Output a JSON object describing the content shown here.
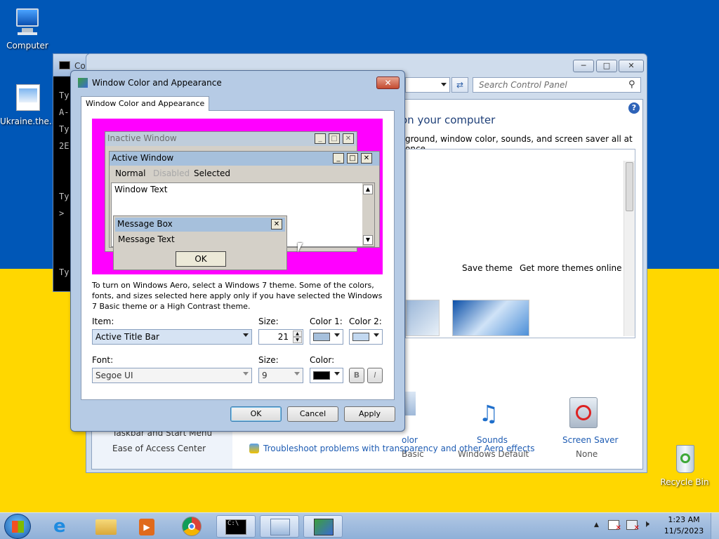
{
  "desktop": {
    "icons": [
      {
        "label": "Computer"
      },
      {
        "label": "Ukraine.the..."
      },
      {
        "label": "Recycle Bin"
      }
    ]
  },
  "cmd": {
    "title": "Co",
    "lines": [
      "Ty",
      "A-",
      "Ty",
      "2E",
      "Ty",
      ">",
      "Ty"
    ]
  },
  "control_panel": {
    "search_placeholder": "Search Control Panel",
    "heading": "on your computer",
    "subtext": "ground, window color, sounds, and screen saver all at once.",
    "save_theme": "Save theme",
    "get_more_themes": "Get more themes online",
    "left_links": [
      "Taskbar and Start Menu",
      "Ease of Access Center"
    ],
    "troubleshoot_link": "Troubleshoot problems with transparency and other Aero effects",
    "bottom_items": [
      {
        "label": "olor",
        "sub": "Basic"
      },
      {
        "label": "Sounds",
        "sub": "Windows Default"
      },
      {
        "label": "Screen Saver",
        "sub": "None"
      }
    ]
  },
  "dialog": {
    "title": "Window Color and Appearance",
    "tab": "Window Color and Appearance",
    "preview": {
      "inactive": "Inactive Window",
      "active": "Active Window",
      "menu_normal": "Normal",
      "menu_disabled": "Disabled",
      "menu_selected": "Selected",
      "window_text": "Window Text",
      "msgbox_title": "Message Box",
      "msgbox_text": "Message Text",
      "msgbox_ok": "OK"
    },
    "info": "To turn on Windows Aero, select a Windows 7 theme.  Some of the colors, fonts, and sizes selected here apply only if you have selected the Windows 7 Basic theme or a High Contrast theme.",
    "item_label": "Item:",
    "item_value": "Active Title Bar",
    "size_label": "Size:",
    "size_value": "21",
    "color1_label": "Color 1:",
    "color2_label": "Color 2:",
    "font_label": "Font:",
    "font_value": "Segoe UI",
    "font_size_label": "Size:",
    "font_size_value": "9",
    "font_color_label": "Color:",
    "bold": "B",
    "italic": "I",
    "ok": "OK",
    "cancel": "Cancel",
    "apply": "Apply",
    "colors": {
      "color1": "#a6c0dc",
      "color2": "#c2d8f0",
      "font_color": "#000000"
    }
  },
  "taskbar": {
    "time": "1:23 AM",
    "date": "11/5/2023"
  }
}
